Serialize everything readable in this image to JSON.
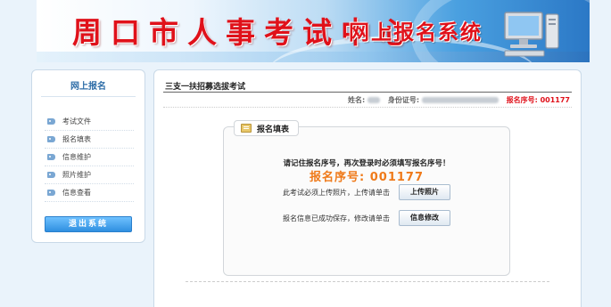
{
  "banner": {
    "site_title": "周口市人事考试中心",
    "system_title": "网上报名系统"
  },
  "sidebar": {
    "title": "网上报名",
    "items": [
      {
        "label": "考试文件",
        "icon": "tag-icon"
      },
      {
        "label": "报名填表",
        "icon": "tag-icon"
      },
      {
        "label": "信息维护",
        "icon": "tag-icon"
      },
      {
        "label": "照片维护",
        "icon": "tag-icon"
      },
      {
        "label": "信息查看",
        "icon": "tag-icon"
      }
    ],
    "exit_label": "退出系统"
  },
  "main": {
    "title": "三支一扶招募选拔考试",
    "info": {
      "name_label": "姓名:",
      "id_label": "身份证号:",
      "reg_label": "报名序号: 001177"
    },
    "form": {
      "legend": "报名填表",
      "notice": "请记住报名序号，再次登录时必须填写报名序号！",
      "reg_number": "报名序号: 001177",
      "upload_msg": "此考试必须上传照片，上传请单击",
      "upload_btn": "上传照片",
      "edit_msg": "报名信息已成功保存，修改请单击",
      "edit_btn": "信息修改"
    }
  },
  "colors": {
    "title_red": "#e0111a",
    "reg_orange": "#ef7a1a",
    "link_blue": "#2f6ea8",
    "exit_blue": "#2f8fe0"
  }
}
